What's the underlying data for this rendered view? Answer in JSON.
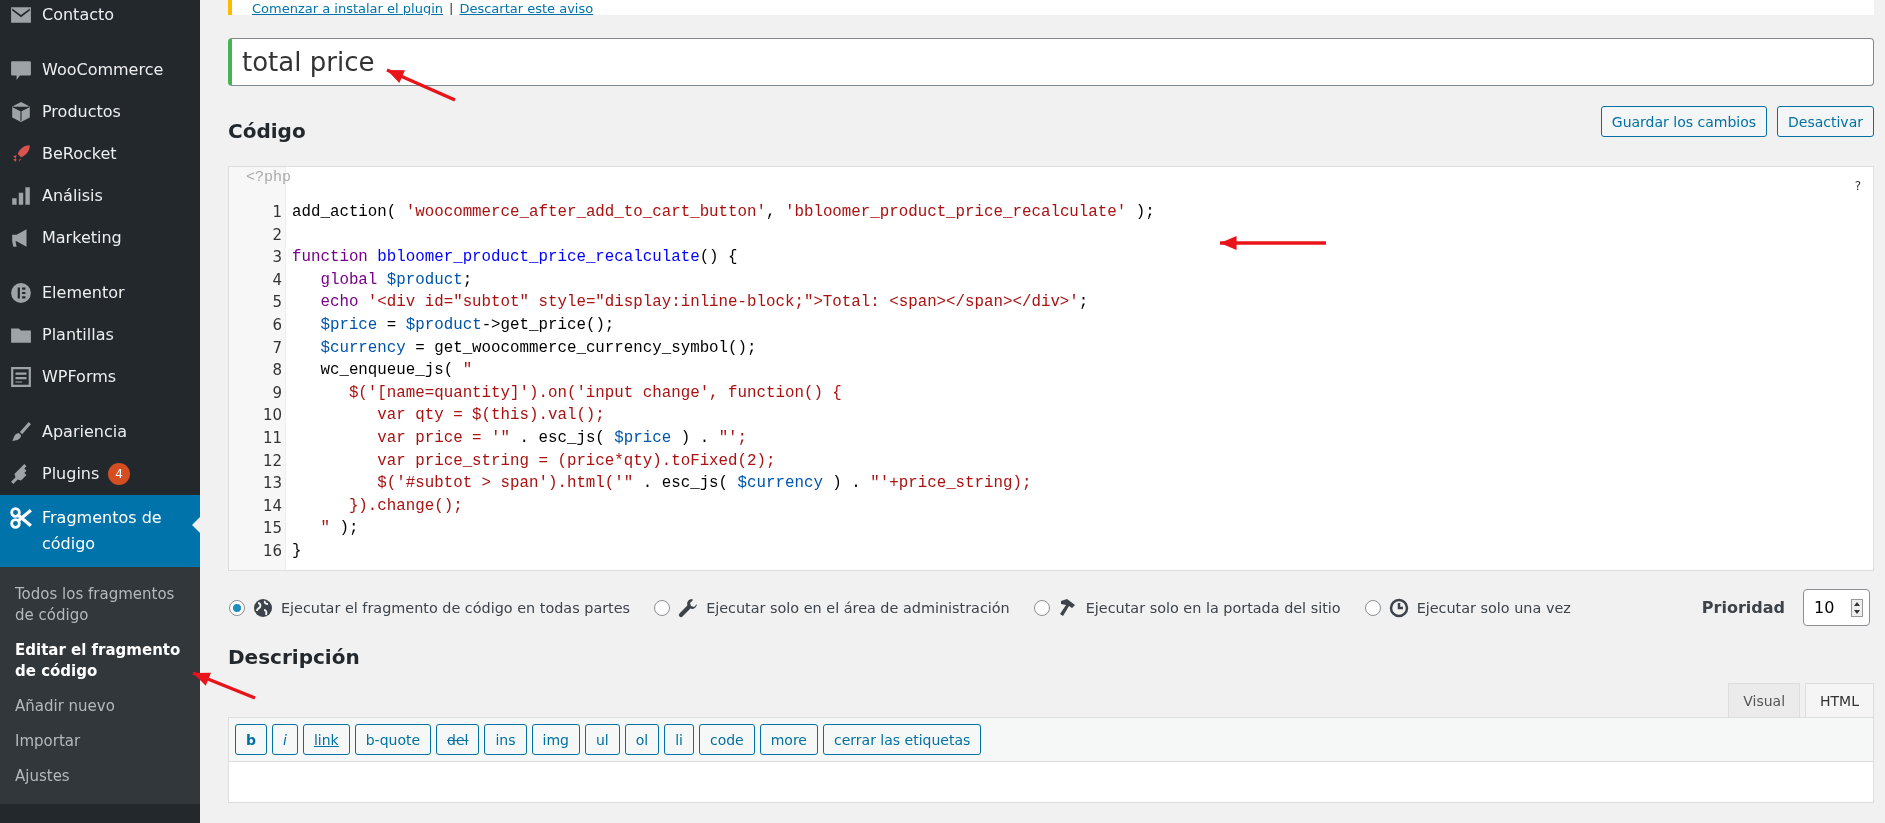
{
  "sidebar": {
    "groups": [
      [
        {
          "label": "Contacto",
          "selected": false
        }
      ],
      [
        {
          "label": "WooCommerce",
          "selected": false
        },
        {
          "label": "Productos",
          "selected": false
        },
        {
          "label": "BeRocket",
          "selected": false
        },
        {
          "label": "Análisis",
          "selected": false
        },
        {
          "label": "Marketing",
          "selected": false
        }
      ],
      [
        {
          "label": "Elementor",
          "selected": false
        },
        {
          "label": "Plantillas",
          "selected": false
        },
        {
          "label": "WPForms",
          "selected": false
        }
      ],
      [
        {
          "label": "Apariencia",
          "selected": false
        },
        {
          "label": "Plugins",
          "badge": "4",
          "selected": false
        },
        {
          "label": "Fragmentos de código",
          "selected": true
        }
      ]
    ],
    "submenu": [
      {
        "label": "Todos los fragmentos de código",
        "selected": false
      },
      {
        "label": "Editar el fragmento de código",
        "selected": true
      },
      {
        "label": "Añadir nuevo",
        "selected": false
      },
      {
        "label": "Importar",
        "selected": false
      },
      {
        "label": "Ajustes",
        "selected": false
      }
    ]
  },
  "notice": {
    "links": [
      "Comenzar a instalar el plugin",
      "Descartar este aviso"
    ],
    "separator": "|"
  },
  "title_field": {
    "value": "total price"
  },
  "code_section": {
    "heading": "Código",
    "buttons": [
      "Guardar los cambios",
      "Desactivar"
    ]
  },
  "code_editor": {
    "header": "<?php",
    "help": "?",
    "lines": [
      {
        "number": "1",
        "segments": [
          {
            "kind": "plain",
            "text": "add_action( "
          },
          {
            "kind": "string",
            "text": "'woocommerce_after_add_to_cart_button'"
          },
          {
            "kind": "plain",
            "text": ", "
          },
          {
            "kind": "string",
            "text": "'bbloomer_product_price_recalculate'"
          },
          {
            "kind": "plain",
            "text": " );"
          }
        ]
      },
      {
        "number": "2"
      },
      {
        "number": "3",
        "segments": [
          {
            "kind": "keyword",
            "text": "function "
          },
          {
            "kind": "def",
            "text": "bbloomer_product_price_recalculate"
          },
          {
            "kind": "plain",
            "text": "() {"
          }
        ]
      },
      {
        "number": "4",
        "segments": [
          {
            "kind": "keyword",
            "text": "   global "
          },
          {
            "kind": "variable",
            "text": "$product"
          },
          {
            "kind": "plain",
            "text": ";"
          }
        ]
      },
      {
        "number": "5",
        "segments": [
          {
            "kind": "keyword",
            "text": "   echo "
          },
          {
            "kind": "string",
            "text": "'<div id=\"subtot\" style=\"display:inline-block;\">Total: <span></span></div>'"
          },
          {
            "kind": "plain",
            "text": ";"
          }
        ]
      },
      {
        "number": "6",
        "segments": [
          {
            "kind": "variable",
            "text": "   $price"
          },
          {
            "kind": "plain",
            "text": " = "
          },
          {
            "kind": "variable",
            "text": "$product"
          },
          {
            "kind": "plain",
            "text": "->get_price();"
          }
        ]
      },
      {
        "number": "7",
        "segments": [
          {
            "kind": "variable",
            "text": "   $currency"
          },
          {
            "kind": "plain",
            "text": " = get_woocommerce_currency_symbol();"
          }
        ]
      },
      {
        "number": "8",
        "segments": [
          {
            "kind": "plain",
            "text": "   wc_enqueue_js( "
          },
          {
            "kind": "string",
            "text": "\""
          }
        ]
      },
      {
        "number": "9",
        "segments": [
          {
            "kind": "string",
            "text": "      $('[name=quantity]').on('input change', function() {"
          }
        ]
      },
      {
        "number": "10",
        "segments": [
          {
            "kind": "string",
            "text": "         var qty = $(this).val();"
          }
        ]
      },
      {
        "number": "11",
        "segments": [
          {
            "kind": "string",
            "text": "         var price = '\""
          },
          {
            "kind": "plain",
            "text": " . esc_js( "
          },
          {
            "kind": "variable",
            "text": "$price"
          },
          {
            "kind": "plain",
            "text": " ) . "
          },
          {
            "kind": "string",
            "text": "\"';"
          }
        ]
      },
      {
        "number": "12",
        "segments": [
          {
            "kind": "string",
            "text": "         var price_string = (price*qty).toFixed(2);"
          }
        ]
      },
      {
        "number": "13",
        "segments": [
          {
            "kind": "string",
            "text": "         $('#subtot > span').html('\""
          },
          {
            "kind": "plain",
            "text": " . esc_js( "
          },
          {
            "kind": "variable",
            "text": "$currency"
          },
          {
            "kind": "plain",
            "text": " ) . "
          },
          {
            "kind": "string",
            "text": "\"'+price_string);"
          }
        ]
      },
      {
        "number": "14",
        "segments": [
          {
            "kind": "string",
            "text": "      }).change();"
          }
        ]
      },
      {
        "number": "15",
        "segments": [
          {
            "kind": "string",
            "text": "   \""
          },
          {
            "kind": "plain",
            "text": " );"
          }
        ]
      },
      {
        "number": "16",
        "segments": [
          {
            "kind": "plain",
            "text": "}"
          }
        ]
      }
    ]
  },
  "scope_options": [
    {
      "label": "Ejecutar el fragmento de código en todas partes",
      "selected": true
    },
    {
      "label": "Ejecutar solo en el área de administración",
      "selected": false
    },
    {
      "label": "Ejecutar solo en la portada del sitio",
      "selected": false
    },
    {
      "label": "Ejecutar solo una vez",
      "selected": false
    }
  ],
  "priority": {
    "label": "Prioridad",
    "value": "10"
  },
  "description": {
    "heading": "Descripción",
    "tabs": [
      {
        "label": "Visual",
        "selected": false
      },
      {
        "label": "HTML",
        "selected": true
      }
    ],
    "toolbar": [
      {
        "kind": "bold",
        "label": "b"
      },
      {
        "kind": "italic",
        "label": "i"
      },
      {
        "kind": "link",
        "label": "link"
      },
      {
        "kind": "plain",
        "label": "b-quote"
      },
      {
        "kind": "strike",
        "label": "del"
      },
      {
        "kind": "plain",
        "label": "ins"
      },
      {
        "kind": "plain",
        "label": "img"
      },
      {
        "kind": "plain",
        "label": "ul"
      },
      {
        "kind": "plain",
        "label": "ol"
      },
      {
        "kind": "plain",
        "label": "li"
      },
      {
        "kind": "plain",
        "label": "code"
      },
      {
        "kind": "plain",
        "label": "more"
      },
      {
        "kind": "plain",
        "label": "cerrar las etiquetas"
      }
    ]
  }
}
